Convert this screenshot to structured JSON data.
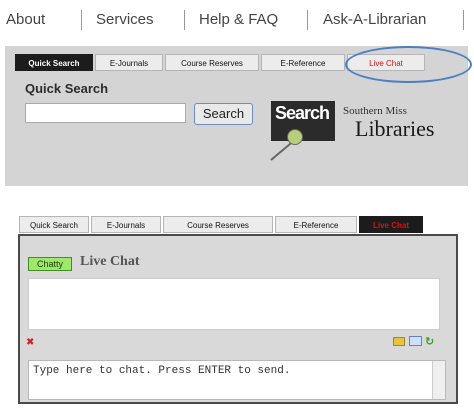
{
  "topnav": {
    "links": [
      "About",
      "Services",
      "Help & FAQ",
      "Ask-A-Librarian"
    ]
  },
  "quick_search_widget": {
    "tabs": [
      "Quick Search",
      "E-Journals",
      "Course Reserves",
      "E-Reference",
      "Live Chat"
    ],
    "active_tab": "Quick Search",
    "heading": "Quick Search",
    "search_input_value": "",
    "search_button": "Search",
    "logo": {
      "search_word": "Search",
      "subtitle": "Southern Miss",
      "main": "Libraries"
    }
  },
  "live_chat_widget": {
    "tabs": [
      "Quick Search",
      "E-Journals",
      "Course Reserves",
      "E-Reference",
      "Live Chat"
    ],
    "active_tab": "Live Chat",
    "status_badge": "Chatty",
    "title": "Live Chat",
    "message_placeholder": "Type here to chat. Press ENTER to send."
  },
  "colors": {
    "active_tab_bg": "#1c1c1c",
    "live_chat_tab_text": "#d21414",
    "highlight_oval": "#4b7fc4",
    "status_badge_bg": "#9de86a"
  },
  "icons": [
    "red-x-icon",
    "folder-icon",
    "mail-icon",
    "green-arrow-icon"
  ]
}
